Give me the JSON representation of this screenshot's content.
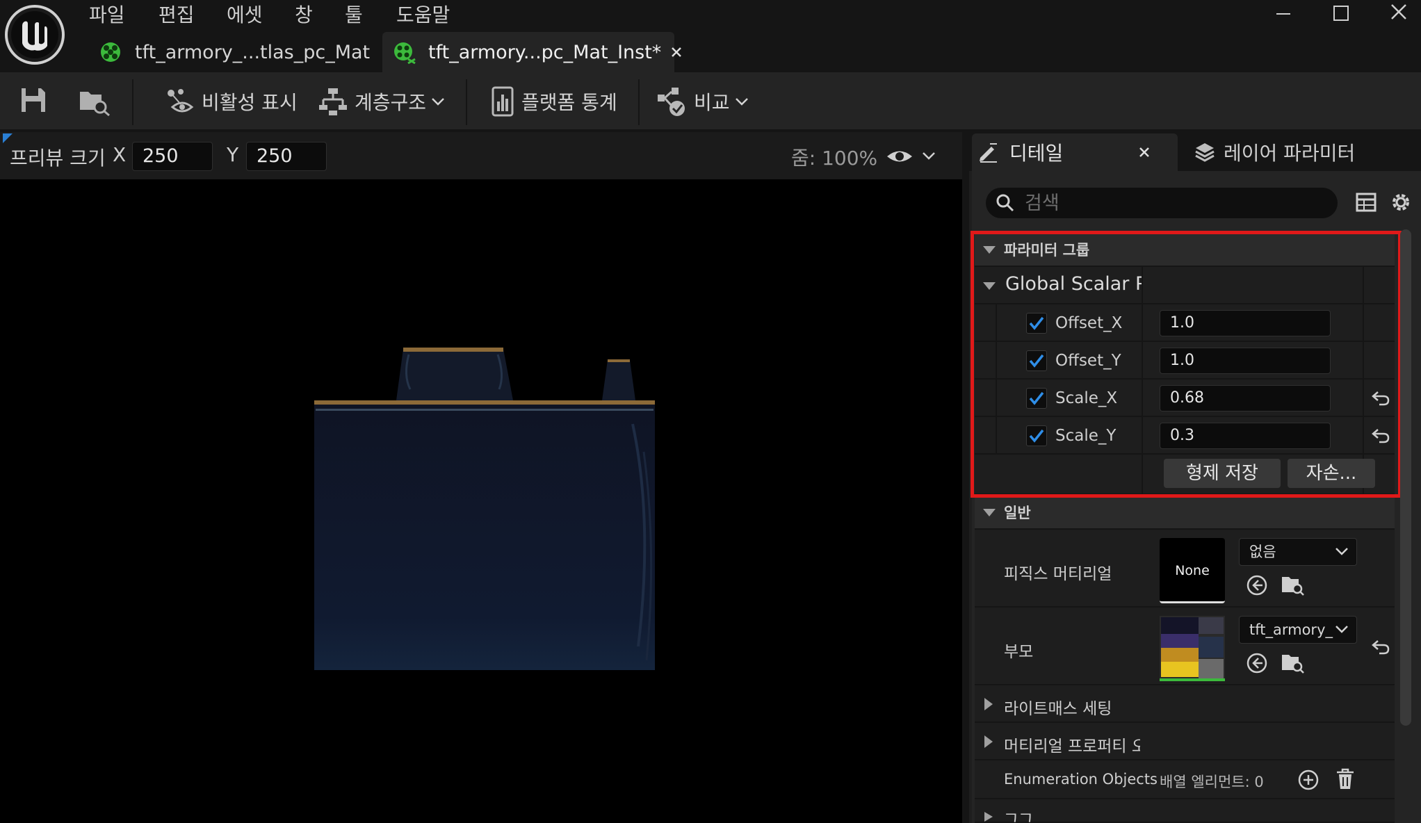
{
  "menu": [
    "파일",
    "편집",
    "에셋",
    "창",
    "툴",
    "도움말"
  ],
  "tabs": [
    {
      "label": "tft_armory_...tlas_pc_Mat",
      "active": false
    },
    {
      "label": "tft_armory...pc_Mat_Inst*",
      "active": true
    }
  ],
  "toolbar": {
    "visibility_label": "비활성 표시",
    "hierarchy_label": "계층구조",
    "platform_stats_label": "플랫폼 통계",
    "compare_label": "비교"
  },
  "preview": {
    "size_label": "프리뷰 크기",
    "x_label": "X",
    "x_value": "250",
    "y_label": "Y",
    "y_value": "250",
    "zoom_text": "줌: 100%"
  },
  "panel": {
    "details_tab": "디테일",
    "layer_tab": "레이어 파라미터",
    "search_placeholder": "검색",
    "param_group_title": "파라미터 그룹",
    "global_scalar_title": "Global Scalar Pa",
    "params": [
      {
        "name": "Offset_X",
        "value": "1.0",
        "checked": true,
        "reset": false
      },
      {
        "name": "Offset_Y",
        "value": "1.0",
        "checked": true,
        "reset": false
      },
      {
        "name": "Scale_X",
        "value": "0.68",
        "checked": true,
        "reset": true
      },
      {
        "name": "Scale_Y",
        "value": "0.3",
        "checked": true,
        "reset": true
      }
    ],
    "save_siblings_label": "형제 저장",
    "save_child_label": "자손...",
    "general_title": "일반",
    "phys_material_label": "피직스 머티리얼",
    "phys_material_thumb_text": "None",
    "phys_material_combo": "없음",
    "parent_label": "부모",
    "parent_combo": "tft_armory_",
    "lightmass_label": "라이트매스 세팅",
    "material_props_label": "머티리얼 프로퍼티 오",
    "enum_label": "Enumeration Objects",
    "enum_value": "배열 엘리먼트: 0",
    "truncated_label": "그그"
  },
  "colors": {
    "accent_blue": "#2a7fd4",
    "highlight_red": "#e01919",
    "check_blue": "#2f8ee8",
    "tab_green": "#3cba3c"
  }
}
